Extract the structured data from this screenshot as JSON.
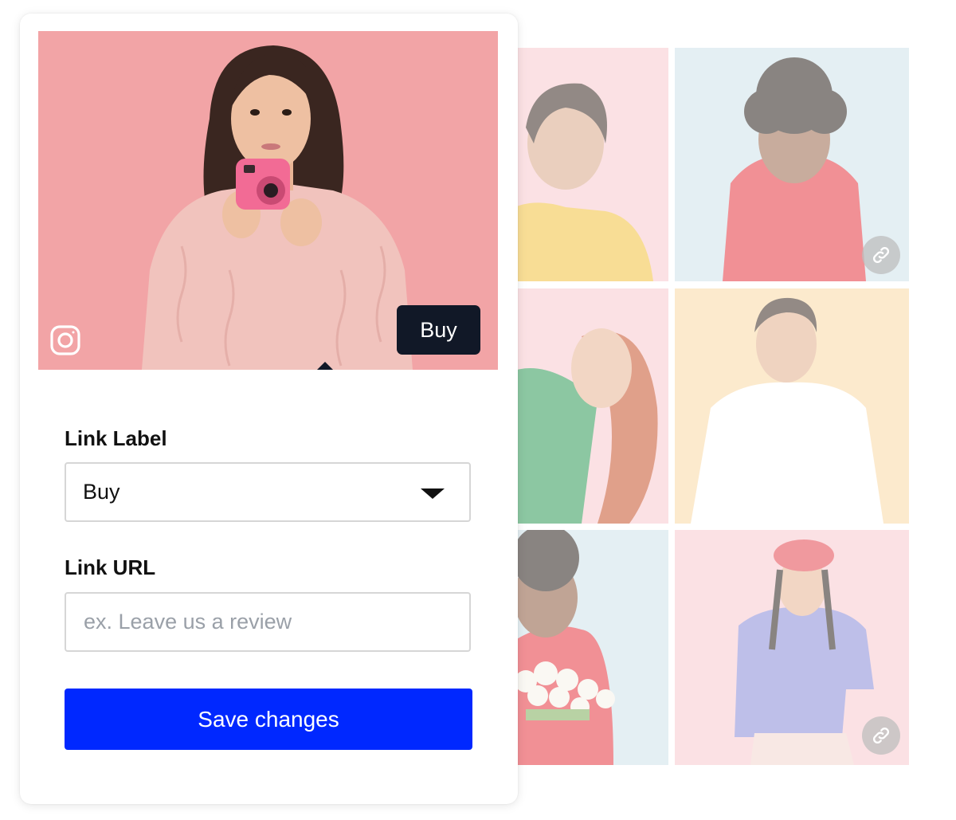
{
  "preview": {
    "badge_label": "Buy",
    "social_icon": "instagram-icon"
  },
  "form": {
    "link_label": {
      "label": "Link Label",
      "selected_value": "Buy"
    },
    "link_url": {
      "label": "Link URL",
      "value": "",
      "placeholder": "ex. Leave us a review"
    },
    "save_button_label": "Save changes"
  },
  "gallery": {
    "link_icon": "link-icon",
    "tiles": [
      {
        "bg": "#f9c9cf",
        "sweater": "#f3c23f"
      },
      {
        "bg": "#cfe2ea",
        "sweater": "#e6363f"
      },
      {
        "bg": "#f9c9cf",
        "sweater": "#2f9b57"
      },
      {
        "bg": "#fbd9a6",
        "sweater": "#ffffff"
      },
      {
        "bg": "#cfe2ea",
        "sweater": "#e6363f"
      },
      {
        "bg": "#f9c9cf",
        "sweater": "#8a8cd8"
      }
    ]
  },
  "colors": {
    "primary": "#0028ff",
    "badge_bg": "#111827",
    "hero_bg": "#f2a4a6"
  }
}
